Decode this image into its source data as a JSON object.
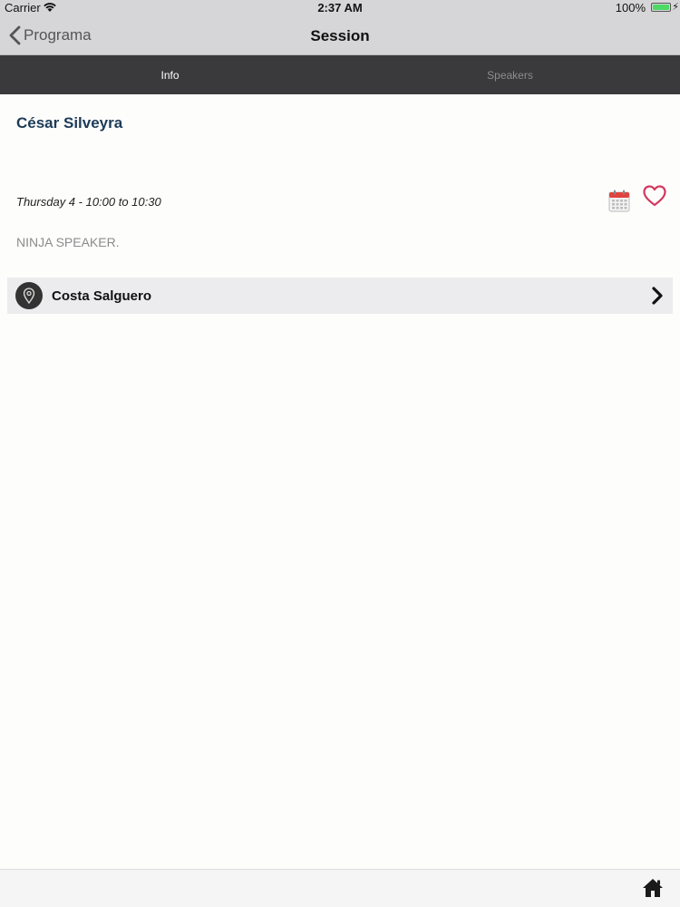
{
  "status_bar": {
    "carrier": "Carrier",
    "time": "2:37 AM",
    "battery": "100%",
    "icons": [
      "wifi-icon",
      "battery-icon",
      "charging-icon"
    ]
  },
  "nav": {
    "back_label": "Programa",
    "title": "Session"
  },
  "tabs": [
    {
      "label": "Info",
      "active": true
    },
    {
      "label": "Speakers",
      "active": false
    }
  ],
  "session": {
    "title": "César Silveyra",
    "time": "Thursday 4 - 10:00 to 10:30",
    "description": "NINJA SPEAKER."
  },
  "location": {
    "name": "Costa Salguero",
    "icon": "map-pin-icon"
  },
  "colors": {
    "title": "#1d3b57",
    "tab_bar": "#3a3a3c",
    "heart": "#d23a5f",
    "calendar_red": "#e0443e"
  }
}
